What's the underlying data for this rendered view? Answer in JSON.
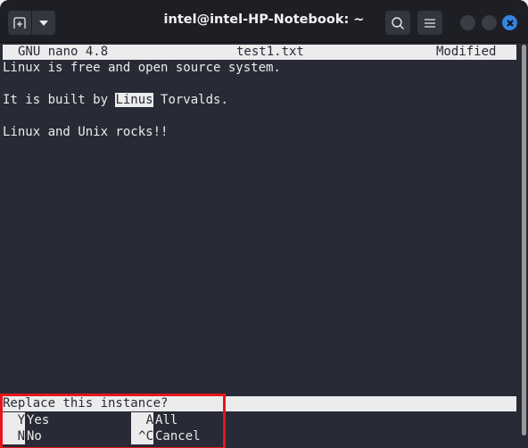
{
  "window": {
    "title": "intel@intel-HP-Notebook: ~",
    "buttons": {
      "new_tab": "new-tab-icon",
      "tab_menu": "chevron-down-icon",
      "search": "search-icon",
      "menu": "hamburger-menu-icon",
      "minimize": "minimize-icon",
      "maximize": "maximize-icon",
      "close": "close-icon"
    },
    "accent_color": "#3584e4"
  },
  "nano": {
    "version_label": "GNU nano 4.8",
    "filename": "test1.txt",
    "status": "Modified",
    "lines": [
      "Linux is free and open source system.",
      "",
      "It is built by ",
      "",
      "Linux and Unix rocks!!"
    ],
    "line3_highlight": "Linus",
    "line3_after": " Torvalds.",
    "prompt": "Replace this instance?",
    "shortcuts": [
      {
        "key": "Y",
        "label": "Yes"
      },
      {
        "key": "A",
        "label": "All"
      },
      {
        "key": "N",
        "label": "No"
      },
      {
        "key": "^C",
        "label": "Cancel"
      }
    ]
  },
  "annotation": {
    "highlight_color": "#e8141b"
  }
}
